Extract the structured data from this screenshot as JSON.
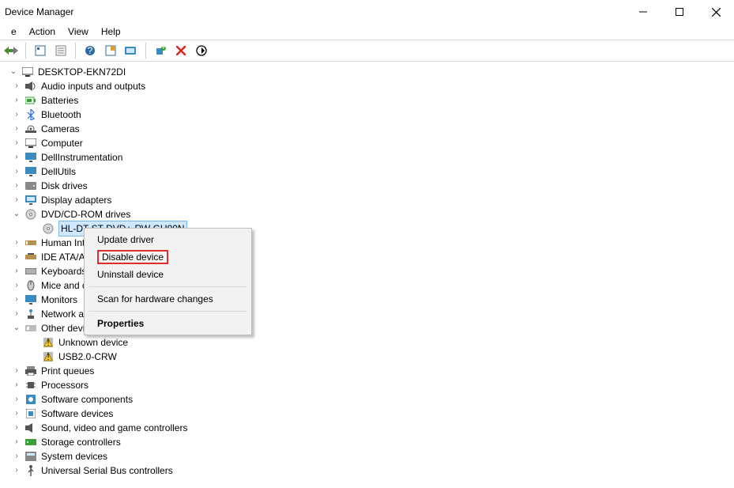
{
  "window": {
    "title": "Device Manager"
  },
  "menu": {
    "items": [
      "e",
      "Action",
      "View",
      "Help"
    ]
  },
  "toolbar": {
    "buttons": [
      {
        "name": "back-forward-icon"
      },
      {
        "name": "show-hidden-icon"
      },
      {
        "name": "properties-icon"
      },
      {
        "name": "help-icon"
      },
      {
        "name": "action-icon"
      },
      {
        "name": "scan-hardware-icon"
      },
      {
        "name": "add-legacy-icon"
      },
      {
        "name": "remove-icon"
      },
      {
        "name": "refresh-icon"
      }
    ]
  },
  "tree": {
    "root": "DESKTOP-EKN72DI",
    "items": [
      {
        "label": "Audio inputs and outputs",
        "icon": "audio-icon"
      },
      {
        "label": "Batteries",
        "icon": "battery-icon"
      },
      {
        "label": "Bluetooth",
        "icon": "bluetooth-icon"
      },
      {
        "label": "Cameras",
        "icon": "camera-icon"
      },
      {
        "label": "Computer",
        "icon": "computer-icon"
      },
      {
        "label": "DellInstrumentation",
        "icon": "monitor-icon"
      },
      {
        "label": "DellUtils",
        "icon": "monitor-icon"
      },
      {
        "label": "Disk drives",
        "icon": "disk-icon"
      },
      {
        "label": "Display adapters",
        "icon": "display-icon"
      },
      {
        "label": "DVD/CD-ROM drives",
        "icon": "dvd-icon",
        "expanded": true,
        "children": [
          {
            "label": "HL-DT-ST DVD+-RW GU90N",
            "icon": "dvd-icon",
            "selected": true
          }
        ]
      },
      {
        "label": "Human Interface Devices",
        "icon": "hid-icon"
      },
      {
        "label": "IDE ATA/ATAPI controllers",
        "icon": "ide-icon"
      },
      {
        "label": "Keyboards",
        "icon": "keyboard-icon"
      },
      {
        "label": "Mice and other pointing devices",
        "icon": "mouse-icon"
      },
      {
        "label": "Monitors",
        "icon": "monitor-icon"
      },
      {
        "label": "Network adapters",
        "icon": "network-icon"
      },
      {
        "label": "Other devices",
        "icon": "other-icon",
        "expanded": true,
        "children": [
          {
            "label": "Unknown device",
            "icon": "warn-icon"
          },
          {
            "label": "USB2.0-CRW",
            "icon": "warn-icon"
          }
        ]
      },
      {
        "label": "Print queues",
        "icon": "printer-icon"
      },
      {
        "label": "Processors",
        "icon": "cpu-icon"
      },
      {
        "label": "Software components",
        "icon": "swcomp-icon"
      },
      {
        "label": "Software devices",
        "icon": "swdev-icon"
      },
      {
        "label": "Sound, video and game controllers",
        "icon": "sound-icon"
      },
      {
        "label": "Storage controllers",
        "icon": "storage-icon"
      },
      {
        "label": "System devices",
        "icon": "system-icon"
      },
      {
        "label": "Universal Serial Bus controllers",
        "icon": "usb-icon"
      }
    ]
  },
  "context_menu": {
    "items": [
      {
        "label": "Update driver"
      },
      {
        "label": "Disable device",
        "highlighted": true
      },
      {
        "label": "Uninstall device"
      },
      {
        "sep": true
      },
      {
        "label": "Scan for hardware changes"
      },
      {
        "sep": true
      },
      {
        "label": "Properties",
        "bold": true
      }
    ]
  }
}
